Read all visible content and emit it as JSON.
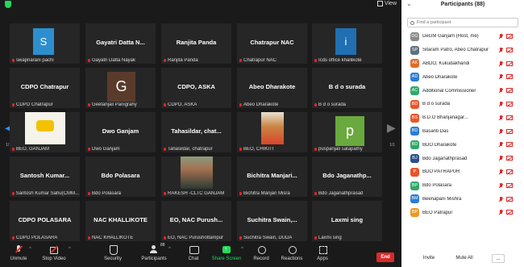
{
  "topbar": {
    "view_label": "View"
  },
  "nav": {
    "left_arrow": "◀",
    "right_arrow": "▶",
    "page_left": "1/1",
    "page_right": "1/1"
  },
  "tiles": [
    {
      "title": "",
      "avatar": "S",
      "avatar_type": "s",
      "label": "swapnarani pachi"
    },
    {
      "title": "Gayatri Datta N...",
      "label": "Gayatri Datta Nayak"
    },
    {
      "title": "Ranjita Panda",
      "label": "Ranjita Panda"
    },
    {
      "title": "Chatrapur NAC",
      "label": "Chatrapur NAC"
    },
    {
      "title": "",
      "avatar": "i",
      "avatar_type": "i",
      "label": "Icds office khallikote"
    },
    {
      "title": "CDPO Chatrapur",
      "label": "CDPO Chatrapur"
    },
    {
      "title": "",
      "avatar": "G",
      "avatar_type": "g",
      "label": "Geetanjali Panigrahy"
    },
    {
      "title": "CDPO, ASKA",
      "label": "CDPO, ASKA"
    },
    {
      "title": "Abeo Dharakote",
      "label": "Abeo Dharakote"
    },
    {
      "title": "B d o surada",
      "label": "B d o surada"
    },
    {
      "title": "",
      "photo": "graduation",
      "label": "BEO, GANJAM"
    },
    {
      "title": "Dwo Ganjam",
      "label": "Dwo Ganjam"
    },
    {
      "title": "Tahasildar,  chat...",
      "label": "Tahasildar, chatrapur"
    },
    {
      "title": "",
      "photo": "person-a",
      "label": "BEO, CHIKITI"
    },
    {
      "title": "",
      "avatar": "p",
      "avatar_type": "p",
      "label": "puspanjali satapathy"
    },
    {
      "title": "Santosh  Kumar...",
      "label": "Santosh Kumar Sahu(CMM..."
    },
    {
      "title": "Bdo Polasara",
      "label": "Bdo Polasara"
    },
    {
      "title": "",
      "photo": "person-b",
      "label": "RAKESH -CLTC GANJAM"
    },
    {
      "title": "Bichitra  Manjari...",
      "label": "Bichitra Manjari Misra"
    },
    {
      "title": "Bdo  Jaganathp...",
      "label": "Bdo Jaganathprasad"
    },
    {
      "title": "CDPO POLASARA",
      "label": "CDPO POLASARA"
    },
    {
      "title": "NAC KHALLIKOTE",
      "label": "NAC KHALLIKOTE"
    },
    {
      "title": "EO, NAC Purush...",
      "label": "EO, NAC Purushottampur"
    },
    {
      "title": "Suchitra  Swain,...",
      "label": "Suchitra Swain, DUDA"
    },
    {
      "title": "Laxmi sing",
      "label": "Laxmi sing"
    }
  ],
  "toolbar": {
    "unmute": "Unmute",
    "stop_video": "Stop Video",
    "security": "Security",
    "participants": "Participants",
    "participants_count": "88",
    "chat": "Chat",
    "share_screen": "Share Screen",
    "record": "Record",
    "reactions": "Reactions",
    "apps": "Apps",
    "end": "End"
  },
  "panel": {
    "title": "Participants (88)",
    "search_placeholder": "Find a participant",
    "participants": [
      {
        "initials": "DG",
        "name": "DeGM Ganjam (Host, me)",
        "color": "#8a8a8a"
      },
      {
        "initials": "SP",
        "name": "Sitaram Patro, Abeo Chatrapur",
        "color": "#607080"
      },
      {
        "initials": "AK",
        "name": "ABDO, Kukudakhandi",
        "color": "#e06c2a"
      },
      {
        "initials": "AD",
        "name": "Abeo Dharakote",
        "color": "#2b7bd6"
      },
      {
        "initials": "AC",
        "name": "Additional Commissioner",
        "color": "#2fa86a"
      },
      {
        "initials": "BD",
        "name": "B d o surada",
        "color": "#e8562a"
      },
      {
        "initials": "BS",
        "name": "B.D.O Bhanjanagar...",
        "color": "#e8562a"
      },
      {
        "initials": "BD",
        "name": "Basanti Das",
        "color": "#2b7bd6"
      },
      {
        "initials": "BD",
        "name": "BDO Dharakote",
        "color": "#2fa86a"
      },
      {
        "initials": "BJ",
        "name": "Bdo Jaganathprasad",
        "color": "#2b4f8a"
      },
      {
        "initials": "P",
        "name": "BDO PATRAPUR",
        "color": "#e8562a"
      },
      {
        "initials": "BP",
        "name": "Bdo Polasara",
        "color": "#2fa86a"
      },
      {
        "initials": "BM",
        "name": "Beenapani Mishra",
        "color": "#2b7bd6"
      },
      {
        "initials": "BP",
        "name": "BEO Patrapur",
        "color": "#e89a2a"
      }
    ],
    "invite": "Invite",
    "mute_all": "Mute All",
    "more": "..."
  }
}
